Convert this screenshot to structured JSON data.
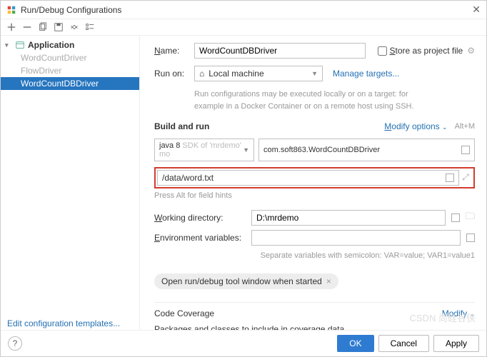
{
  "window": {
    "title": "Run/Debug Configurations"
  },
  "sidebar": {
    "root": "Application",
    "items": [
      {
        "label": "WordCountDriver",
        "selected": false,
        "dim": true
      },
      {
        "label": "FlowDriver",
        "selected": false,
        "dim": true
      },
      {
        "label": "WordCountDBDriver",
        "selected": true,
        "dim": false
      }
    ]
  },
  "form": {
    "name_label": "Name:",
    "name_value": "WordCountDBDriver",
    "store_label": "Store as project file",
    "runon_label": "Run on:",
    "runon_value": "Local machine",
    "manage_targets": "Manage targets...",
    "runon_hint": "Run configurations may be executed locally or on a target: for example in a Docker Container or on a remote host using SSH.",
    "build_title": "Build and run",
    "modify_options": "Modify options",
    "modify_shortcut": "Alt+M",
    "sdk_prefix": "java 8",
    "sdk_suffix": "SDK of 'mrdemo' mo",
    "main_class": "com.soft863.WordCountDBDriver",
    "program_args": "/data/word.txt",
    "args_hint": "Press Alt for field hints",
    "workdir_label": "Working directory:",
    "workdir_value": "D:\\mrdemo",
    "env_label": "Environment variables:",
    "env_value": "",
    "env_hint": "Separate variables with semicolon: VAR=value; VAR1=value1",
    "chip_label": "Open run/debug tool window when started",
    "coverage_title": "Code Coverage",
    "coverage_modify": "Modify",
    "coverage_pkg": "Packages and classes to include in coverage data"
  },
  "footer": {
    "edit_templates": "Edit configuration templates...",
    "ok": "OK",
    "cancel": "Cancel",
    "apply": "Apply"
  },
  "watermark": "CSDN 尚硅谷侠"
}
